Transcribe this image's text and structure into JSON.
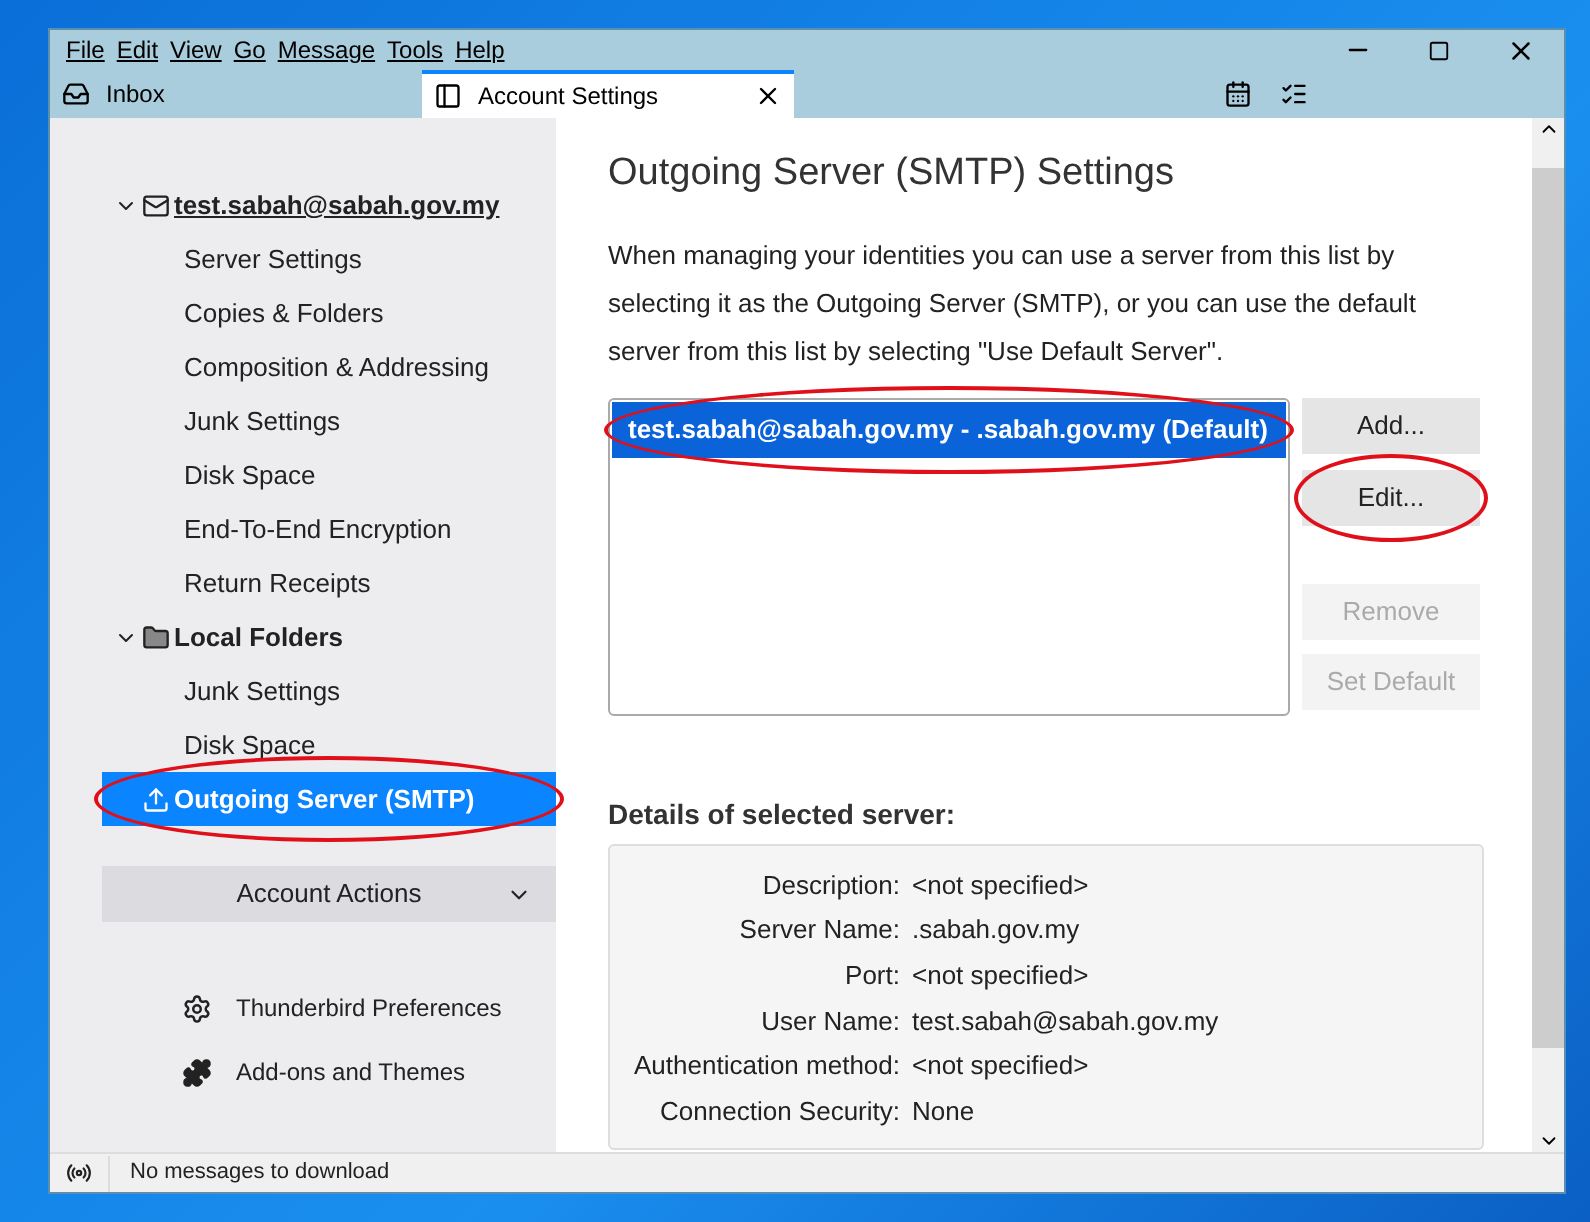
{
  "menu": [
    "File",
    "Edit",
    "View",
    "Go",
    "Message",
    "Tools",
    "Help"
  ],
  "tabs": [
    {
      "label": "Inbox",
      "kind": "inbox",
      "selected": false
    },
    {
      "label": "Account Settings",
      "kind": "settings",
      "selected": true
    }
  ],
  "sidebar": {
    "tree": [
      {
        "label": "test.sabah@sabah.gov.my",
        "kind": "mail",
        "expanded": true,
        "selected": false,
        "annotated": false,
        "children": [
          {
            "label": "Server Settings",
            "selected": false
          },
          {
            "label": "Copies & Folders",
            "selected": false
          },
          {
            "label": "Composition & Addressing",
            "selected": false
          },
          {
            "label": "Junk Settings",
            "selected": false
          },
          {
            "label": "Disk Space",
            "selected": false
          },
          {
            "label": "End-To-End Encryption",
            "selected": false
          },
          {
            "label": "Return Receipts",
            "selected": false
          }
        ]
      },
      {
        "label": "Local Folders",
        "kind": "folder",
        "expanded": true,
        "selected": false,
        "annotated": false,
        "children": [
          {
            "label": "Junk Settings",
            "selected": false
          },
          {
            "label": "Disk Space",
            "selected": false
          }
        ]
      },
      {
        "label": "Outgoing Server (SMTP)",
        "kind": "smtp",
        "selected": true,
        "annotated": true
      }
    ],
    "account_actions": "Account Actions",
    "links": [
      {
        "label": "Thunderbird Preferences",
        "kind": "gear"
      },
      {
        "label": "Add-ons and Themes",
        "kind": "puzzle"
      }
    ]
  },
  "content": {
    "title": "Outgoing Server (SMTP) Settings",
    "description": "When managing your identities you can use a server from this list by selecting it as the Outgoing Server (SMTP), or you can use the default server from this list by selecting \"Use Default Server\".",
    "servers": [
      {
        "label": "test.sabah@sabah.gov.my - .sabah.gov.my (Default)",
        "selected": true,
        "annotated": true
      }
    ],
    "buttons": [
      {
        "label": "Add...",
        "disabled": false,
        "annotated": false
      },
      {
        "label": "Edit...",
        "disabled": false,
        "annotated": true
      },
      {
        "label": "Remove",
        "disabled": true,
        "annotated": false
      },
      {
        "label": "Set Default",
        "disabled": true,
        "annotated": false
      }
    ],
    "details_heading": "Details of selected server:",
    "details": [
      {
        "label": "Description:",
        "value": "<not specified>"
      },
      {
        "label": "Server Name:",
        "value": ".sabah.gov.my"
      },
      {
        "label": "Port:",
        "value": "<not specified>"
      },
      {
        "label": "User Name:",
        "value": "test.sabah@sabah.gov.my"
      },
      {
        "label": "Authentication method:",
        "value": "<not specified>"
      },
      {
        "label": "Connection Security:",
        "value": "None"
      }
    ]
  },
  "status_bar": "No messages to download"
}
